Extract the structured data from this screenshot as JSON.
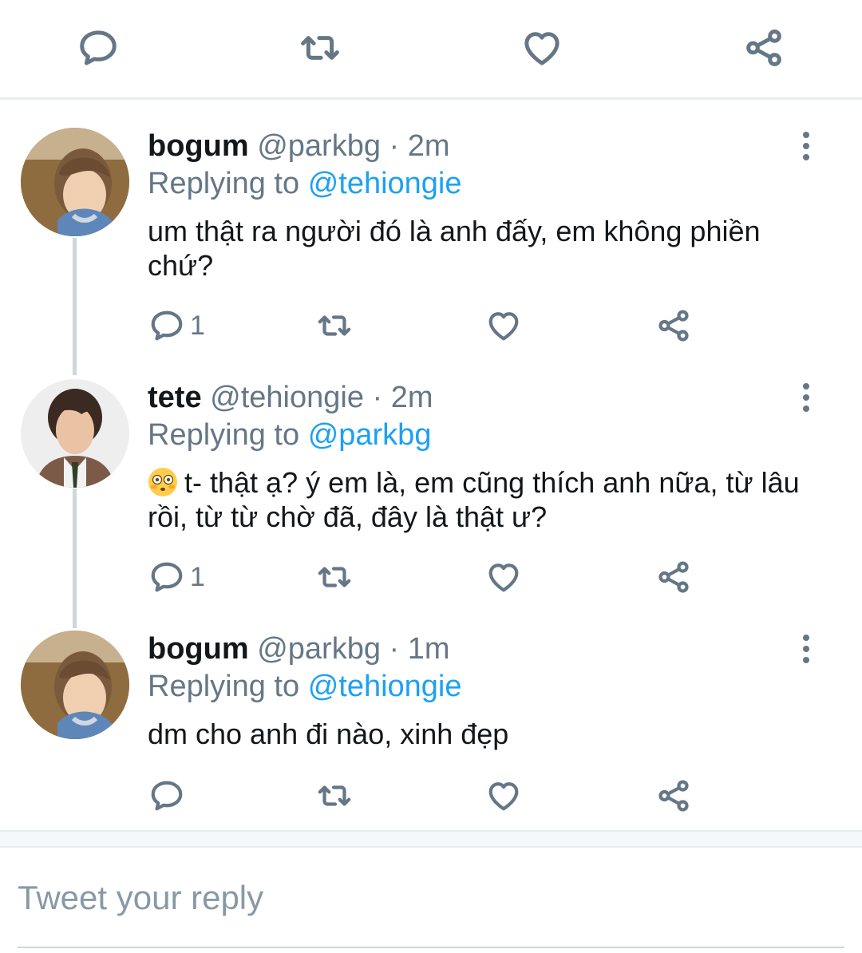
{
  "top_actions": {
    "reply_icon": "reply-icon",
    "retweet_icon": "retweet-icon",
    "like_icon": "heart-icon",
    "share_icon": "share-icon"
  },
  "colors": {
    "link": "#1da1f2",
    "muted": "#657786",
    "line": "#ccd6dd"
  },
  "tweets": [
    {
      "name": "bogum",
      "handle": "@parkbg",
      "separator": "·",
      "time": "2m",
      "replying_prefix": "Replying to",
      "replying_to": "@tehiongie",
      "text": "um thật ra người đó là anh đấy, em không phiền chứ?",
      "reply_count": "1"
    },
    {
      "name": "tete",
      "handle": "@tehiongie",
      "separator": "·",
      "time": "2m",
      "replying_prefix": "Replying to",
      "replying_to": "@parkbg",
      "emoji": "flushed-face-emoji",
      "text": "t- thật ạ? ý em là, em cũng thích anh nữa, từ lâu rồi, từ từ chờ đã, đây là thật ư?",
      "reply_count": "1"
    },
    {
      "name": "bogum",
      "handle": "@parkbg",
      "separator": "·",
      "time": "1m",
      "replying_prefix": "Replying to",
      "replying_to": "@tehiongie",
      "text": "dm cho anh đi nào, xinh đẹp",
      "reply_count": ""
    }
  ],
  "reply_box": {
    "placeholder": "Tweet your reply"
  }
}
